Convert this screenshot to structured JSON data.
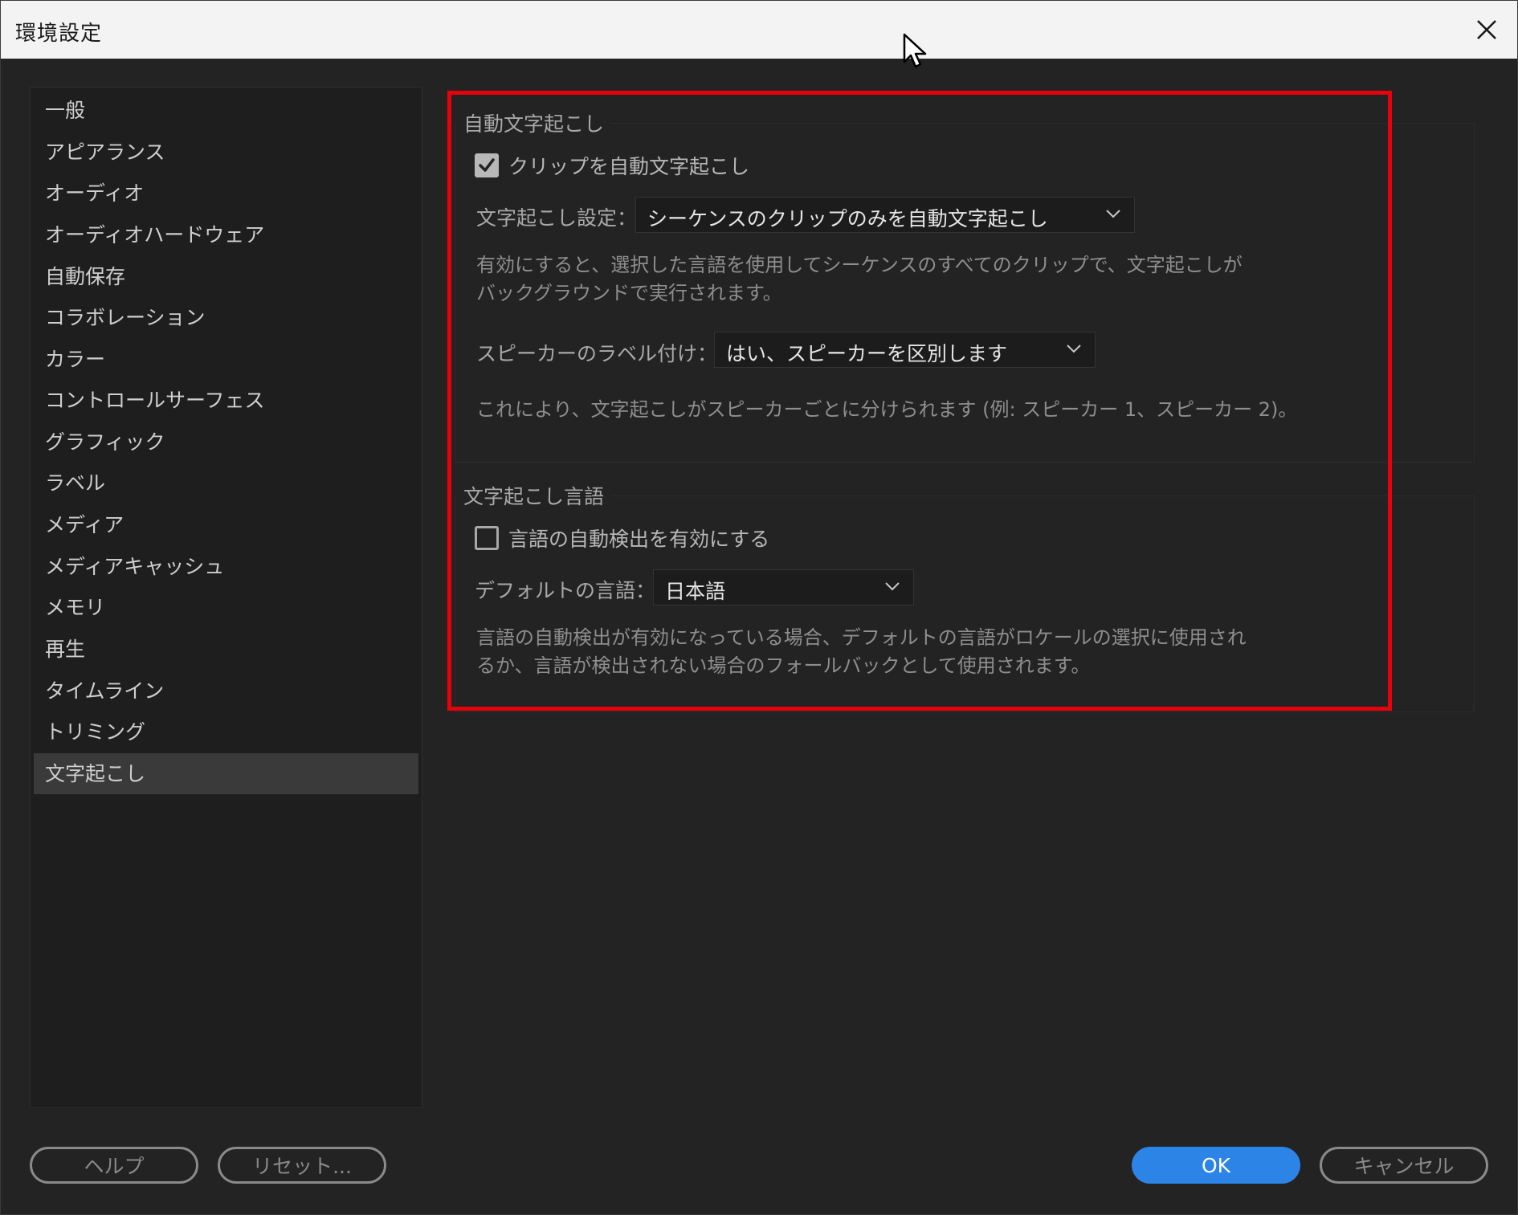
{
  "window": {
    "title": "環境設定"
  },
  "sidebar": {
    "items": [
      {
        "label": "一般"
      },
      {
        "label": "アピアランス"
      },
      {
        "label": "オーディオ"
      },
      {
        "label": "オーディオハードウェア"
      },
      {
        "label": "自動保存"
      },
      {
        "label": "コラボレーション"
      },
      {
        "label": "カラー"
      },
      {
        "label": "コントロールサーフェス"
      },
      {
        "label": "グラフィック"
      },
      {
        "label": "ラベル"
      },
      {
        "label": "メディア"
      },
      {
        "label": "メディアキャッシュ"
      },
      {
        "label": "メモリ"
      },
      {
        "label": "再生"
      },
      {
        "label": "タイムライン"
      },
      {
        "label": "トリミング"
      },
      {
        "label": "文字起こし",
        "selected": true
      }
    ]
  },
  "auto_transcribe": {
    "group_title": "自動文字起こし",
    "checkbox_label": "クリップを自動文字起こし",
    "checked": true,
    "settings_label": "文字起こし設定：",
    "settings_value": "シーケンスのクリップのみを自動文字起こし",
    "settings_desc_line1": "有効にすると、選択した言語を使用してシーケンスのすべてのクリップで、文字起こしが",
    "settings_desc_line2": "バックグラウンドで実行されます。",
    "speaker_label": "スピーカーのラベル付け：",
    "speaker_value": "はい、スピーカーを区別します",
    "speaker_desc": "これにより、文字起こしがスピーカーごとに分けられます (例: スピーカー 1、スピーカー 2)。"
  },
  "language": {
    "group_title": "文字起こし言語",
    "auto_detect_label": "言語の自動検出を有効にする",
    "auto_detect_checked": false,
    "default_label": "デフォルトの言語：",
    "default_value": "日本語",
    "desc_line1": "言語の自動検出が有効になっている場合、デフォルトの言語がロケールの選択に使用され",
    "desc_line2": "るか、言語が検出されない場合のフォールバックとして使用されます。"
  },
  "footer": {
    "help_label": "ヘルプ",
    "reset_label": "リセット...",
    "ok_label": "OK",
    "cancel_label": "キャンセル"
  },
  "colors": {
    "accent": "#2b84e6",
    "highlight_box": "#e8000d",
    "background": "#232323"
  },
  "icons": [
    "close-icon",
    "mouse-cursor-icon",
    "checkmark-icon",
    "chevron-down-icon"
  ]
}
